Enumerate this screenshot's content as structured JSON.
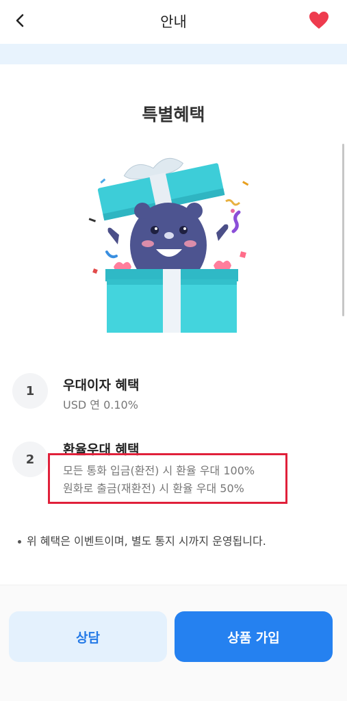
{
  "header": {
    "title": "안내",
    "back_icon": "chevron-left-icon",
    "favorite_icon": "heart-icon",
    "favorite_color": "#ee3b4e"
  },
  "section": {
    "title": "특별혜택",
    "illustration": "gift-box-bear-illustration"
  },
  "benefits": [
    {
      "number": "1",
      "title": "우대이자 혜택",
      "lines": [
        "USD 연 0.10%"
      ]
    },
    {
      "number": "2",
      "title": "환율우대 혜택",
      "lines": [
        "모든 통화 입금(환전) 시 환율 우대 100%",
        "원화로 출금(재환전) 시 환율 우대 50%"
      ]
    }
  ],
  "note": "위 혜택은 이벤트이며, 별도 통지 시까지 운영됩니다.",
  "footer": {
    "consult_label": "상담",
    "join_label": "상품 가입"
  },
  "colors": {
    "accent": "#2581f0",
    "accent_light": "#e4f1fd",
    "highlight": "#e0203a"
  }
}
